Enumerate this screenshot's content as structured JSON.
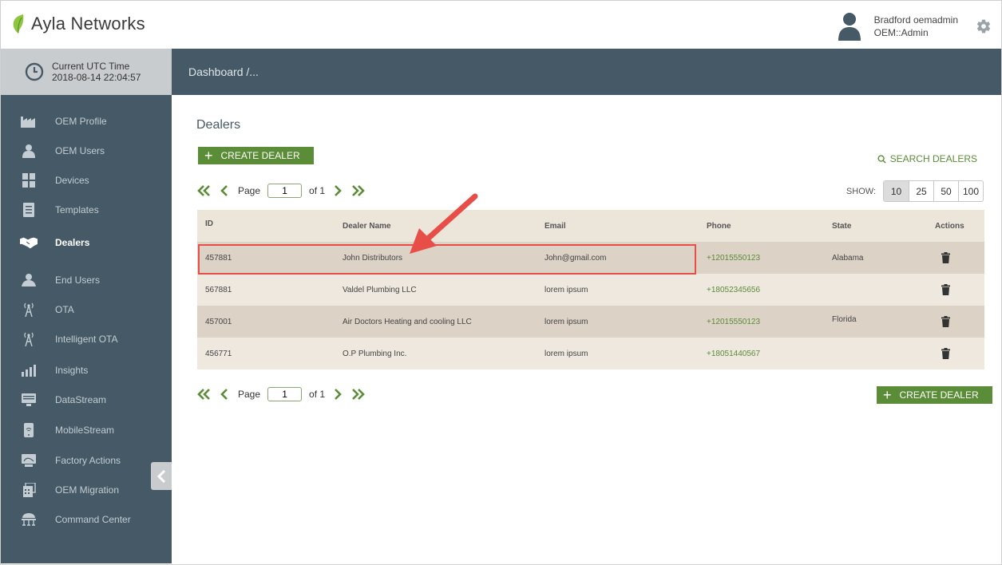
{
  "header": {
    "brand": "Ayla Networks",
    "user_name": "Bradford oemadmin",
    "user_role": "OEM::Admin"
  },
  "time": {
    "label": "Current UTC Time",
    "value": "2018-08-14 22:04:57"
  },
  "breadcrumb": "Dashboard /...",
  "sidebar": {
    "items": [
      {
        "label": "OEM Profile",
        "icon": "factory-icon"
      },
      {
        "label": "OEM Users",
        "icon": "user-badge-icon"
      },
      {
        "label": "Devices",
        "icon": "devices-icon"
      },
      {
        "label": "Templates",
        "icon": "templates-icon"
      },
      {
        "label": "Dealers",
        "icon": "handshake-icon",
        "active": true
      },
      {
        "label": "End Users",
        "icon": "users-icon"
      },
      {
        "label": "OTA",
        "icon": "antenna-icon"
      },
      {
        "label": "Intelligent OTA",
        "icon": "antenna-icon"
      },
      {
        "label": "Insights",
        "icon": "insights-chart-icon"
      },
      {
        "label": "DataStream",
        "icon": "datastream-icon"
      },
      {
        "label": "MobileStream",
        "icon": "mobile-icon"
      },
      {
        "label": "Factory Actions",
        "icon": "factory-actions-icon"
      },
      {
        "label": "OEM Migration",
        "icon": "migration-icon"
      },
      {
        "label": "Command Center",
        "icon": "command-center-icon"
      }
    ]
  },
  "main": {
    "title": "Dealers",
    "create_label": "CREATE DEALER",
    "search_label": "SEARCH DEALERS",
    "pager": {
      "page_label": "Page",
      "page_value": "1",
      "of_label": "of 1"
    },
    "show": {
      "label": "SHOW:",
      "options": [
        "10",
        "25",
        "50",
        "100"
      ]
    },
    "table": {
      "headers": {
        "id": "ID",
        "name": "Dealer Name",
        "email": "Email",
        "phone": "Phone",
        "state": "State",
        "actions": "Actions"
      },
      "rows": [
        {
          "id": "457881",
          "name": "John Distributors",
          "email": "John@gmail.com",
          "phone": "+12015550123",
          "state": "Alabama"
        },
        {
          "id": "567881",
          "name": "Valdel Plumbing LLC",
          "email": "lorem ipsum",
          "phone": "+18052345656",
          "state": ""
        },
        {
          "id": "457001",
          "name": "Air Doctors Heating and cooling LLC",
          "email": "lorem ipsum",
          "phone": "+12015550123",
          "state": "Florida"
        },
        {
          "id": "456771",
          "name": "O.P Plumbing Inc.",
          "email": "lorem ipsum",
          "phone": "+18051440567",
          "state": ""
        }
      ]
    }
  },
  "colors": {
    "sidebar": "#455a66",
    "accent_green": "#5b8c38",
    "highlight_red": "#e84e48"
  }
}
